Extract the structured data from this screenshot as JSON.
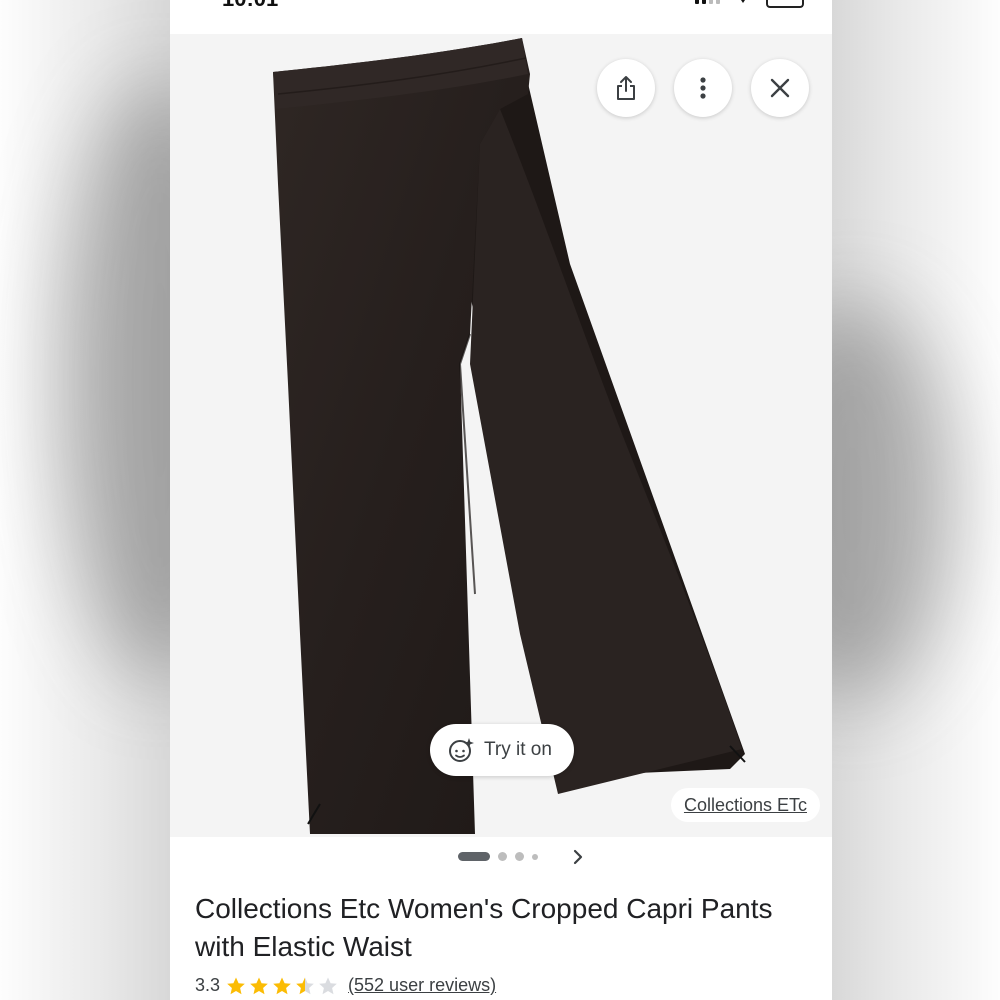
{
  "status_bar": {
    "time": "10:01"
  },
  "image_viewer": {
    "try_on_label": "Try it on",
    "source_label": "Collections ETc",
    "icons": [
      "share-icon",
      "more-vert-icon",
      "close-icon",
      "try-on-icon",
      "chevron-right-icon"
    ],
    "pager": {
      "total_dots": 4,
      "active_index": 0
    }
  },
  "product": {
    "title": "Collections Etc Women's Cropped Capri Pants with Elastic Waist",
    "rating": "3.3",
    "rating_value": 3.3,
    "rating_max": 5,
    "reviews_label": "(552 user reviews)"
  },
  "colors": {
    "star_filled": "#fbbc04",
    "star_empty": "#dadce0",
    "product_color": "#2a2220",
    "image_bg": "#f4f4f4"
  }
}
